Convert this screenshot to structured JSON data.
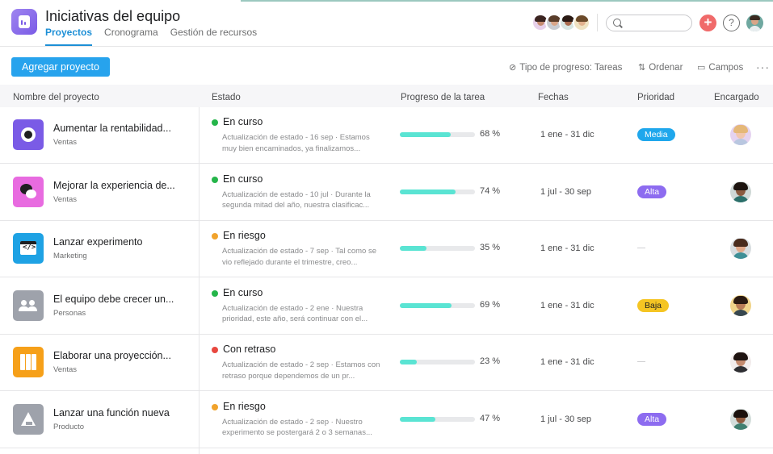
{
  "header": {
    "title": "Iniciativas del equipo",
    "tabs": [
      {
        "label": "Proyectos",
        "active": true
      },
      {
        "label": "Cronograma",
        "active": false
      },
      {
        "label": "Gestión de recursos",
        "active": false
      }
    ],
    "search": {
      "placeholder": "",
      "value": ""
    },
    "plus_label": "+",
    "help_label": "?"
  },
  "toolbar": {
    "add_label": "Agregar proyecto",
    "progress_label": "Tipo de progreso: Tareas",
    "sort_label": "Ordenar",
    "fields_label": "Campos",
    "more_label": "···"
  },
  "columns": [
    "Nombre del proyecto",
    "Estado",
    "Progreso de la tarea",
    "Fechas",
    "Prioridad",
    "Encargado"
  ],
  "colors": {
    "on_track": "#25b54a",
    "at_risk": "#f1a32c",
    "off_track": "#e8483f",
    "accent": "#27a3ed",
    "progress": "#5ae4d3"
  },
  "projects": [
    {
      "name": "Aumentar la rentabilidad...",
      "team": "Ventas",
      "icon": "target-icon",
      "icon_color": "#7a5be6",
      "status": "En curso",
      "status_color": "#25b54a",
      "desc": "Actualización de estado - 16 sep · Estamos muy bien encaminados, ya finalizamos...",
      "progress": 68,
      "progress_label": "68 %",
      "dates": "1 ene - 31 dic",
      "priority": "Media",
      "priority_bg": "#1fa7ec",
      "priority_fg": "#ffffff"
    },
    {
      "name": "Mejorar la experiencia de...",
      "team": "Ventas",
      "icon": "chat-icon",
      "icon_color": "#e86be0",
      "status": "En curso",
      "status_color": "#25b54a",
      "desc": "Actualización de estado - 10 jul · Durante la segunda mitad del año, nuestra clasificac...",
      "progress": 74,
      "progress_label": "74 %",
      "dates": "1 jul - 30 sep",
      "priority": "Alta",
      "priority_bg": "#8d6cf0",
      "priority_fg": "#ffffff"
    },
    {
      "name": "Lanzar experimento",
      "team": "Marketing",
      "icon": "code-icon",
      "icon_color": "#1ea2e4",
      "status": "En riesgo",
      "status_color": "#f1a32c",
      "desc": "Actualización de estado - 7 sep · Tal como se vio reflejado durante el trimestre, creo...",
      "progress": 35,
      "progress_label": "35 %",
      "dates": "1 ene - 31 dic",
      "priority": "",
      "priority_bg": "",
      "priority_fg": ""
    },
    {
      "name": "El equipo debe crecer un...",
      "team": "Personas",
      "icon": "people-icon",
      "icon_color": "#9ea2ab",
      "status": "En curso",
      "status_color": "#25b54a",
      "desc": "Actualización de estado - 2 ene · Nuestra prioridad, este año, será continuar con el...",
      "progress": 69,
      "progress_label": "69 %",
      "dates": "1 ene - 31 dic",
      "priority": "Baja",
      "priority_bg": "#f5c523",
      "priority_fg": "#1e1f21"
    },
    {
      "name": "Elaborar una proyección...",
      "team": "Ventas",
      "icon": "map-icon",
      "icon_color": "#f6a019",
      "status": "Con retraso",
      "status_color": "#e8483f",
      "desc": "Actualización de estado - 2 sep · Estamos con retraso porque dependemos de un pr...",
      "progress": 23,
      "progress_label": "23 %",
      "dates": "1 ene - 31 dic",
      "priority": "",
      "priority_bg": "",
      "priority_fg": ""
    },
    {
      "name": "Lanzar una función nueva",
      "team": "Producto",
      "icon": "mountain-icon",
      "icon_color": "#9ea2ab",
      "status": "En riesgo",
      "status_color": "#f1a32c",
      "desc": "Actualización de estado - 2 sep · Nuestro experimento se postergará 2 o 3 semanas...",
      "progress": 47,
      "progress_label": "47 %",
      "dates": "1 jul - 30 sep",
      "priority": "Alta",
      "priority_bg": "#8d6cf0",
      "priority_fg": "#ffffff"
    }
  ]
}
